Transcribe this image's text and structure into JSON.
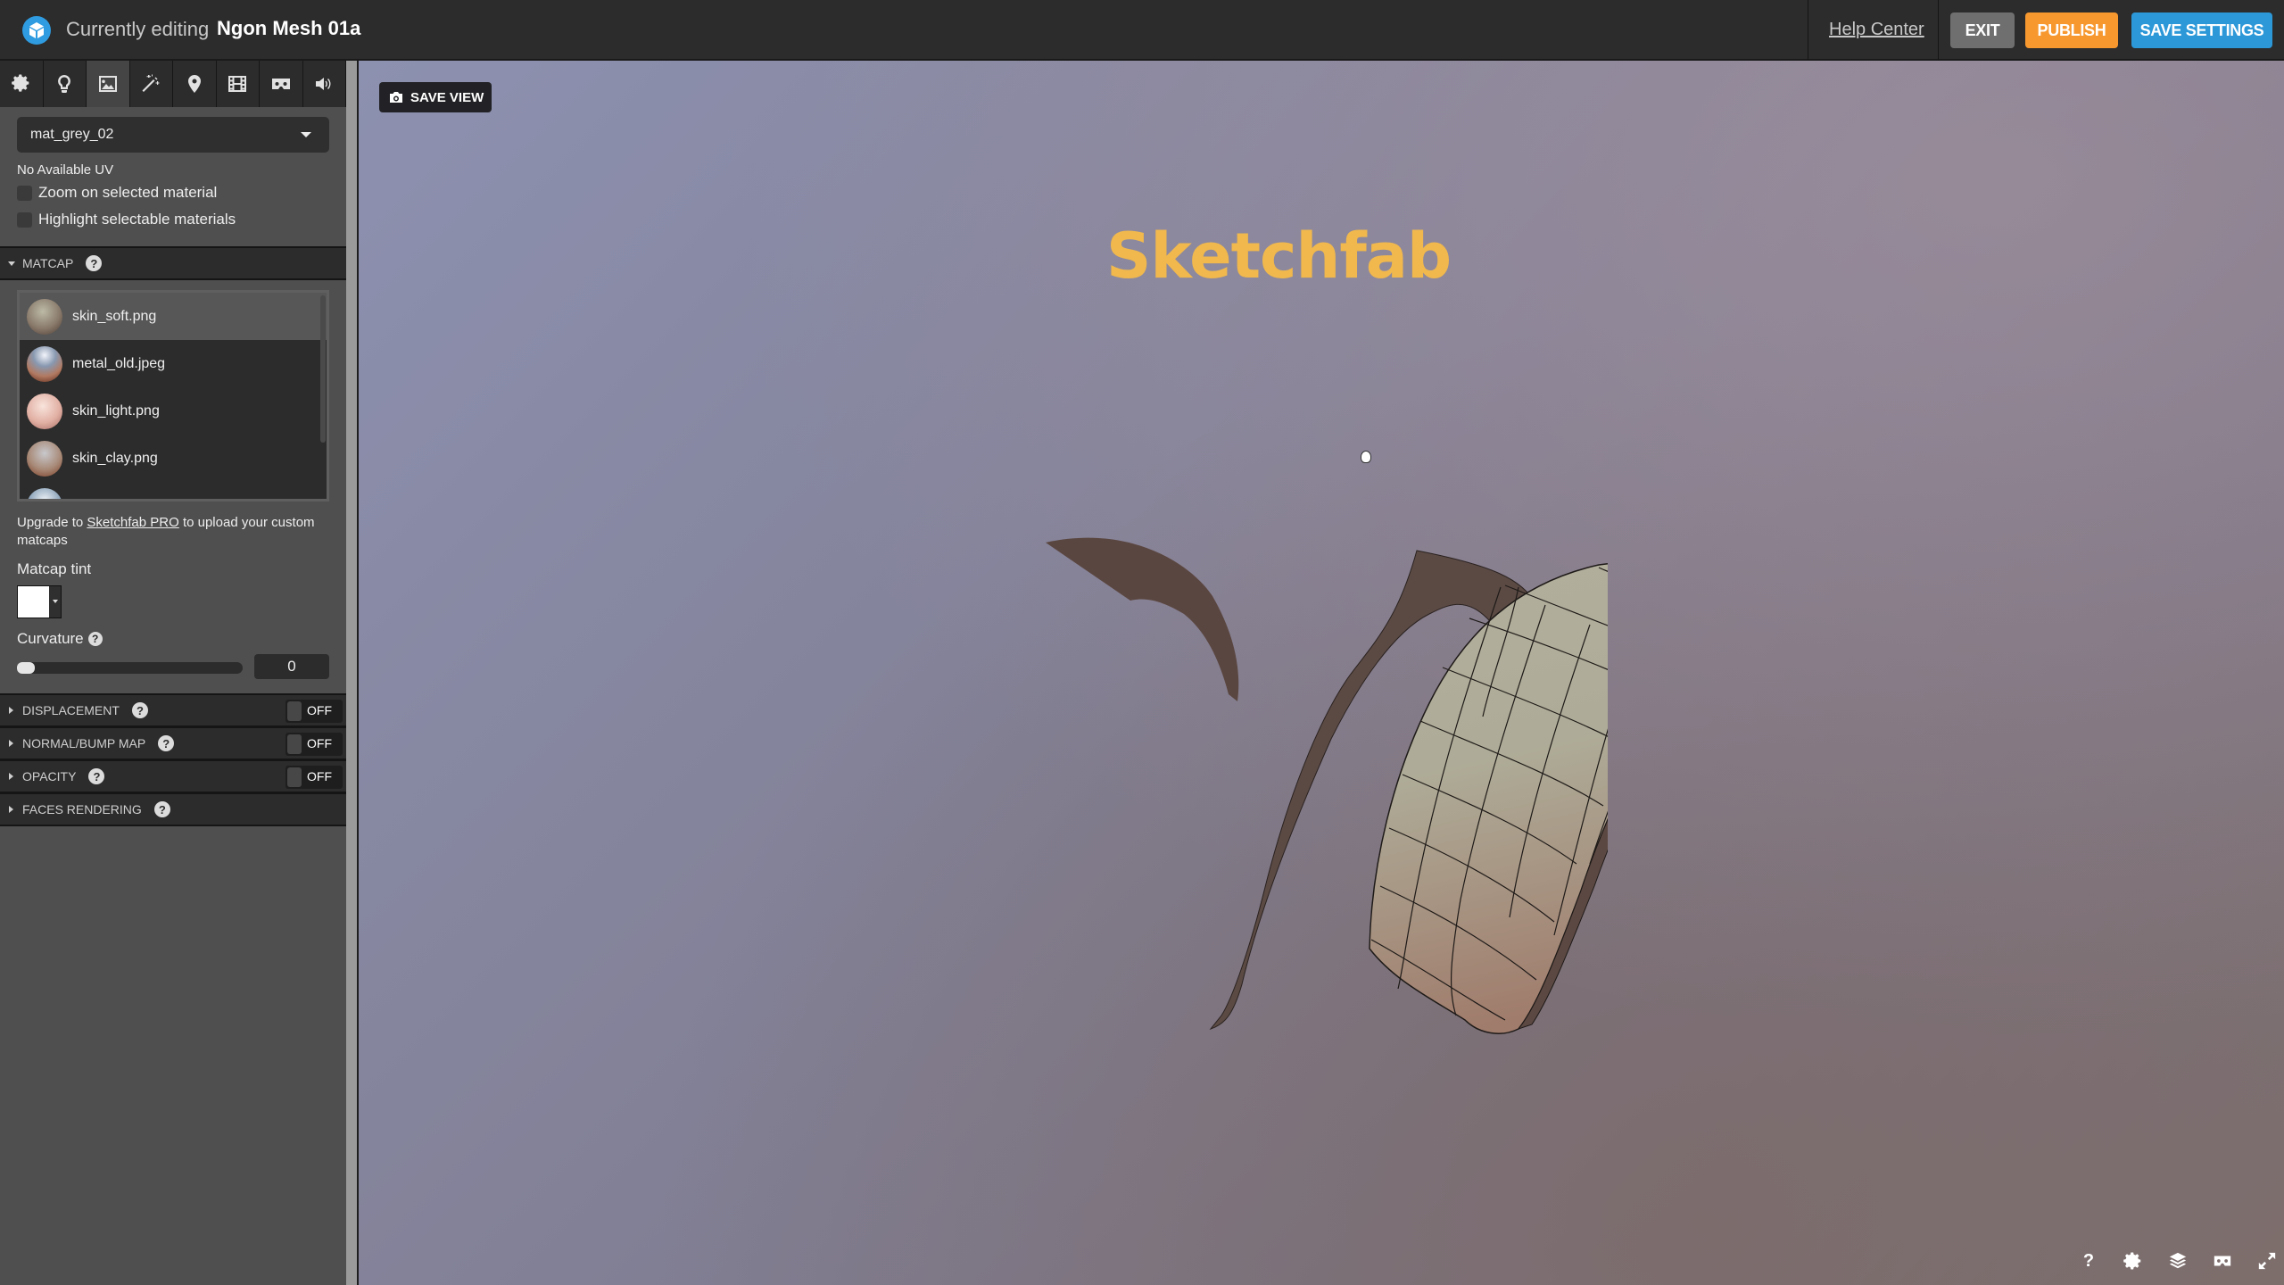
{
  "header": {
    "title_prefix": "Currently editing",
    "model_name": "Ngon Mesh 01a",
    "help_center": "Help Center",
    "exit": "EXIT",
    "publish": "PUBLISH",
    "save_settings": "SAVE SETTINGS",
    "colors": {
      "exit": "#6f6f6f",
      "publish": "#f7982f",
      "save_settings": "#2c98d8",
      "logo": "#2f9be0"
    }
  },
  "sidebar": {
    "tabs": [
      {
        "icon": "gear-icon",
        "label": "General"
      },
      {
        "icon": "lightbulb-icon",
        "label": "Lighting"
      },
      {
        "icon": "image-icon",
        "label": "Materials",
        "active": true
      },
      {
        "icon": "magic-wand-icon",
        "label": "Post Processing"
      },
      {
        "icon": "map-pin-icon",
        "label": "Annotations"
      },
      {
        "icon": "film-icon",
        "label": "Animation"
      },
      {
        "icon": "vr-headset-icon",
        "label": "VR"
      },
      {
        "icon": "sound-icon",
        "label": "Sound"
      }
    ],
    "material_select": "mat_grey_02",
    "no_uv": "No Available UV",
    "zoom_on_selected": "Zoom on selected material",
    "highlight_selectable": "Highlight selectable materials",
    "matcap": {
      "title": "MATCAP",
      "items": [
        {
          "name": "skin_soft.png",
          "selected": true
        },
        {
          "name": "metal_old.jpeg",
          "selected": false
        },
        {
          "name": "skin_light.png",
          "selected": false
        },
        {
          "name": "skin_clay.png",
          "selected": false
        },
        {
          "name": "",
          "selected": false
        }
      ],
      "upgrade_pre": "Upgrade to ",
      "upgrade_link": "Sketchfab PRO",
      "upgrade_post": " to upload your custom matcaps",
      "tint_label": "Matcap tint",
      "tint_color": "#ffffff",
      "curvature_label": "Curvature",
      "curvature_value": "0"
    },
    "sections": [
      {
        "title": "DISPLACEMENT",
        "toggle": "OFF"
      },
      {
        "title": "NORMAL/BUMP MAP",
        "toggle": "OFF"
      },
      {
        "title": "OPACITY",
        "toggle": "OFF"
      },
      {
        "title": "FACES RENDERING"
      }
    ]
  },
  "viewport": {
    "save_view": "SAVE VIEW",
    "brand_watermark": "Sketchfab",
    "bottom_icons": [
      "help-icon",
      "settings-icon",
      "layers-icon",
      "vr-icon",
      "fullscreen-icon"
    ],
    "help_glyph": "?"
  }
}
